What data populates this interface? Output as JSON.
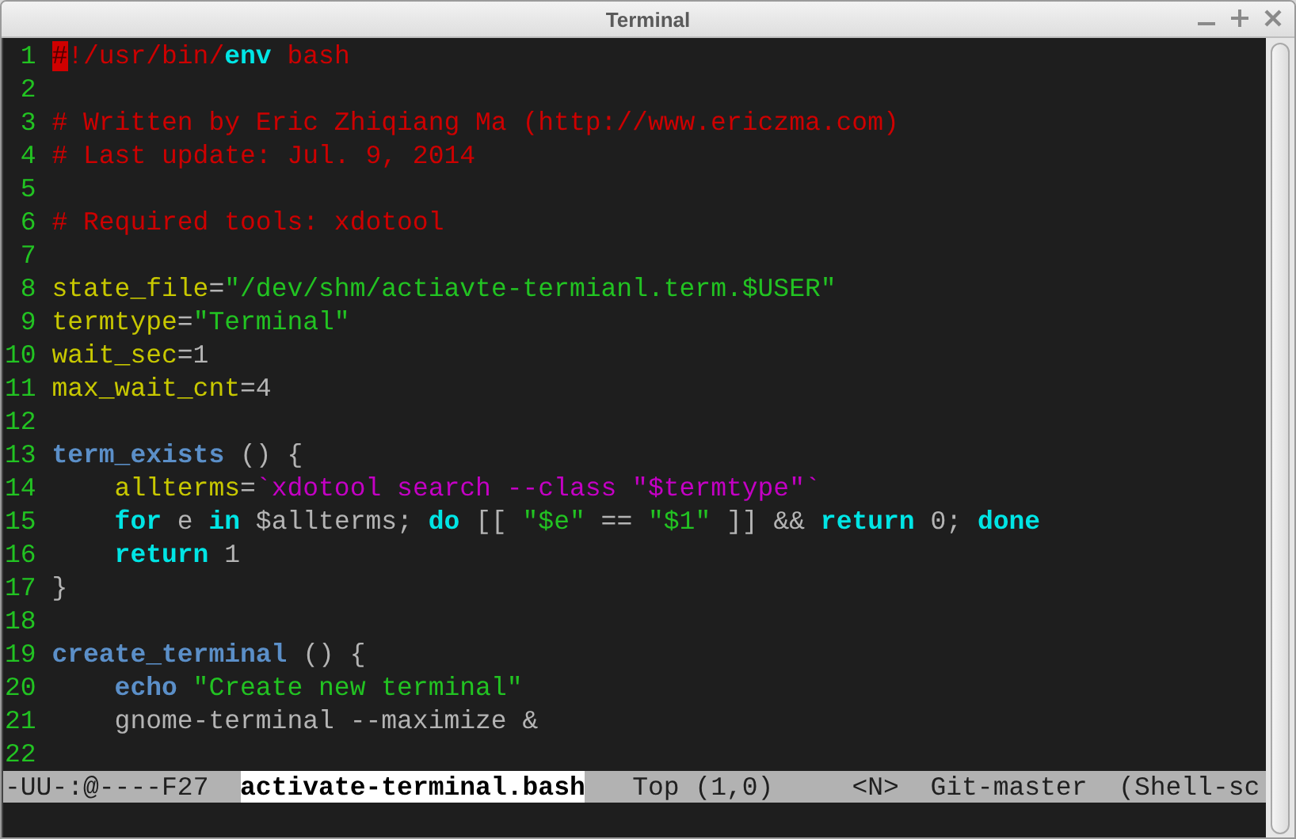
{
  "window": {
    "title": "Terminal"
  },
  "editor": {
    "lines": [
      {
        "number": "1",
        "tokens": [
          {
            "kind": "cursor",
            "text": "#"
          },
          {
            "kind": "comment",
            "text": "!/usr/bin/"
          },
          {
            "kind": "keyword",
            "text": "env"
          },
          {
            "kind": "comment",
            "text": " bash"
          }
        ]
      },
      {
        "number": "2"
      },
      {
        "number": "3",
        "tokens": [
          {
            "kind": "comment",
            "text": "# Written by Eric Zhiqiang Ma (http://www.ericzma.com)"
          }
        ]
      },
      {
        "number": "4",
        "tokens": [
          {
            "kind": "comment",
            "text": "# Last update: Jul. 9, 2014"
          }
        ]
      },
      {
        "number": "5"
      },
      {
        "number": "6",
        "tokens": [
          {
            "kind": "comment",
            "text": "# Required tools: xdotool"
          }
        ]
      },
      {
        "number": "7"
      },
      {
        "number": "8",
        "tokens": [
          {
            "kind": "variable",
            "text": "state_file"
          },
          {
            "kind": "plain",
            "text": "="
          },
          {
            "kind": "string",
            "text": "\"/dev/shm/actiavte-termianl.term.$USER\""
          }
        ]
      },
      {
        "number": "9",
        "tokens": [
          {
            "kind": "variable",
            "text": "termtype"
          },
          {
            "kind": "plain",
            "text": "="
          },
          {
            "kind": "string",
            "text": "\"Terminal\""
          }
        ]
      },
      {
        "number": "10",
        "tokens": [
          {
            "kind": "variable",
            "text": "wait_sec"
          },
          {
            "kind": "plain",
            "text": "=1"
          }
        ]
      },
      {
        "number": "11",
        "tokens": [
          {
            "kind": "variable",
            "text": "max_wait_cnt"
          },
          {
            "kind": "plain",
            "text": "=4"
          }
        ]
      },
      {
        "number": "12"
      },
      {
        "number": "13",
        "tokens": [
          {
            "kind": "function",
            "text": "term_exists"
          },
          {
            "kind": "plain",
            "text": " () {"
          }
        ]
      },
      {
        "number": "14",
        "tokens": [
          {
            "kind": "variable",
            "text": "    allterms"
          },
          {
            "kind": "plain",
            "text": "="
          },
          {
            "kind": "command",
            "text": "`xdotool search --class \"$termtype\"`"
          }
        ]
      },
      {
        "number": "15",
        "tokens": [
          {
            "kind": "keyword",
            "text": "    for"
          },
          {
            "kind": "plain",
            "text": " e "
          },
          {
            "kind": "keyword",
            "text": "in"
          },
          {
            "kind": "plain",
            "text": " $allterms; "
          },
          {
            "kind": "keyword",
            "text": "do"
          },
          {
            "kind": "plain",
            "text": " [[ "
          },
          {
            "kind": "string",
            "text": "\"$e\""
          },
          {
            "kind": "plain",
            "text": " == "
          },
          {
            "kind": "string",
            "text": "\"$1\""
          },
          {
            "kind": "plain",
            "text": " ]] && "
          },
          {
            "kind": "keyword",
            "text": "return"
          },
          {
            "kind": "plain",
            "text": " 0; "
          },
          {
            "kind": "keyword",
            "text": "done"
          }
        ]
      },
      {
        "number": "16",
        "tokens": [
          {
            "kind": "keyword",
            "text": "    return"
          },
          {
            "kind": "plain",
            "text": " 1"
          }
        ]
      },
      {
        "number": "17",
        "tokens": [
          {
            "kind": "plain",
            "text": "}"
          }
        ]
      },
      {
        "number": "18"
      },
      {
        "number": "19",
        "tokens": [
          {
            "kind": "function",
            "text": "create_terminal"
          },
          {
            "kind": "plain",
            "text": " () {"
          }
        ]
      },
      {
        "number": "20",
        "tokens": [
          {
            "kind": "function",
            "text": "    echo"
          },
          {
            "kind": "string",
            "text": " \"Create new terminal\""
          }
        ]
      },
      {
        "number": "21",
        "tokens": [
          {
            "kind": "plain",
            "text": "    gnome-terminal --maximize &"
          }
        ]
      },
      {
        "number": "22"
      }
    ]
  },
  "mode_line": {
    "status": "-UU-:@----F27",
    "buffer_name": "activate-terminal.bash",
    "position": "Top (1,0)",
    "input_mode": "<N>",
    "branch": "Git-master",
    "major_mode": "(Shell-sc"
  }
}
